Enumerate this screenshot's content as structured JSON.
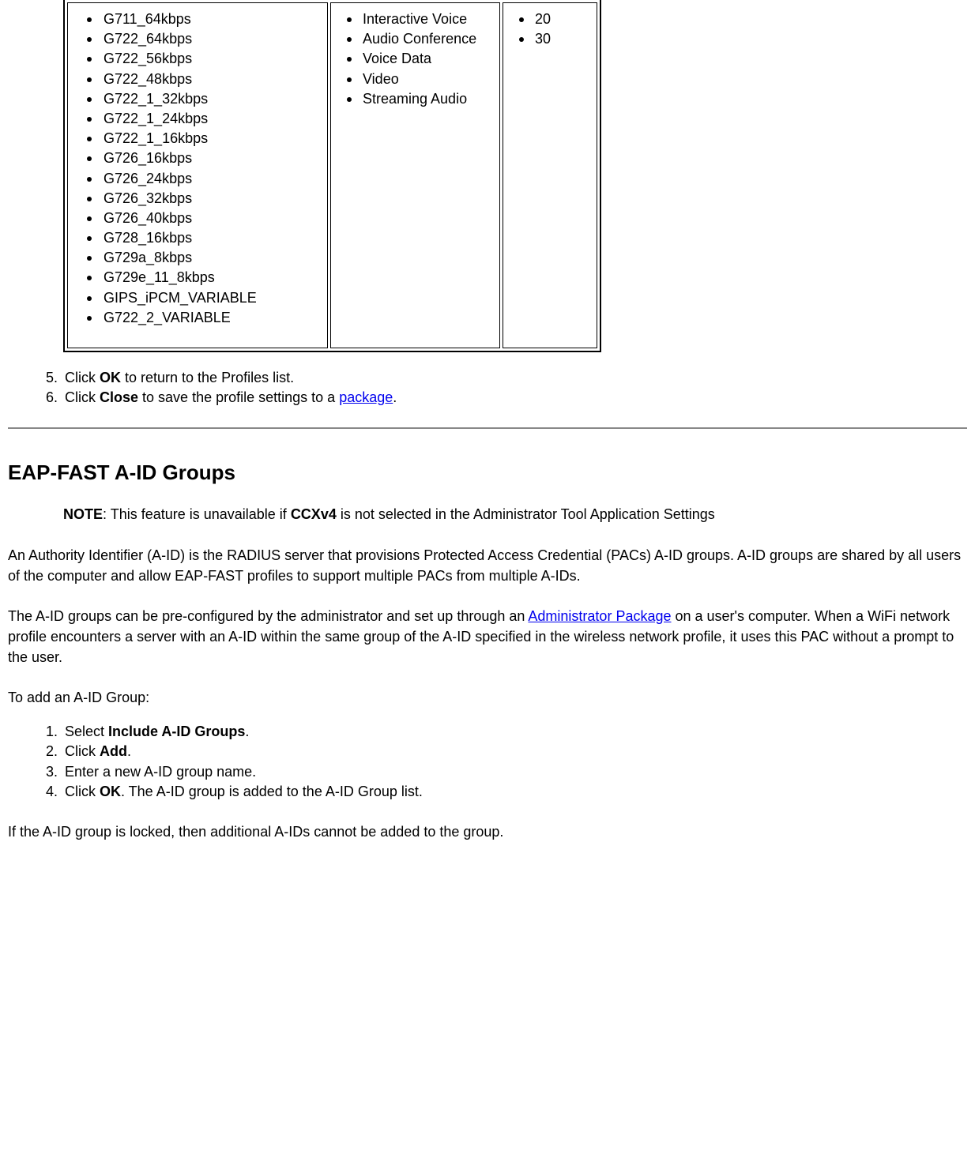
{
  "table": {
    "codecs": [
      "G711_64kbps",
      "G722_64kbps",
      "G722_56kbps",
      "G722_48kbps",
      "G722_1_32kbps",
      "G722_1_24kbps",
      "G722_1_16kbps",
      "G726_16kbps",
      "G726_24kbps",
      "G726_32kbps",
      "G726_40kbps",
      "G728_16kbps",
      "G729a_8kbps",
      "G729e_11_8kbps",
      "GIPS_iPCM_VARIABLE",
      "G722_2_VARIABLE"
    ],
    "categories": [
      "Interactive Voice",
      "Audio Conference",
      "Voice Data",
      "Video",
      "Streaming Audio"
    ],
    "values": [
      "20",
      "30"
    ]
  },
  "steps_a": {
    "start": "5",
    "item5_pre": "Click ",
    "item5_bold": "OK",
    "item5_post": " to return to the Profiles list.",
    "item6_pre": "Click ",
    "item6_bold": "Close",
    "item6_mid": " to save the profile settings to a ",
    "item6_link": "package",
    "item6_post": "."
  },
  "heading": "EAP-FAST A-ID Groups",
  "note": {
    "label": "NOTE",
    "pre": ": This feature is unavailable if ",
    "bold": "CCXv4",
    "post": " is not selected in the Administrator Tool Application Settings"
  },
  "para1": "An Authority Identifier (A-ID) is the RADIUS server that provisions Protected Access Credential (PACs) A-ID groups. A-ID groups are shared by all users of the computer and allow EAP-FAST profiles to support multiple PACs from multiple A-IDs.",
  "para2_pre": "The A-ID groups can be pre-configured by the administrator and set up through an ",
  "para2_link": "Administrator Package",
  "para2_post": " on a user's computer. When a WiFi network profile encounters a server with an A-ID within the same group of the A-ID specified in the wireless network profile, it uses this PAC without a prompt to the user.",
  "para3": "To add an A-ID Group:",
  "steps_b": {
    "item1_pre": "Select ",
    "item1_bold": "Include A-ID Groups",
    "item1_post": ".",
    "item2_pre": "Click ",
    "item2_bold": "Add",
    "item2_post": ".",
    "item3": "Enter a new A-ID group name.",
    "item4_pre": "Click ",
    "item4_bold": "OK",
    "item4_post": ". The A-ID group is added to the A-ID Group list."
  },
  "para4": "If the A-ID group is locked, then additional A-IDs cannot be added to the group."
}
